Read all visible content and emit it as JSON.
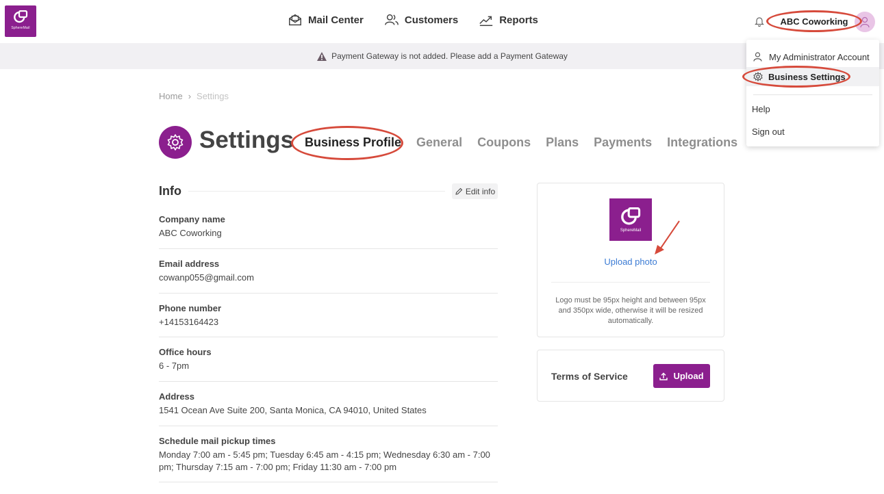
{
  "brand": {
    "name": "SphereMail",
    "color": "#8b1f8e"
  },
  "nav": {
    "items": [
      {
        "label": "Mail Center",
        "icon": "mail-center-icon"
      },
      {
        "label": "Customers",
        "icon": "customers-icon"
      },
      {
        "label": "Reports",
        "icon": "reports-icon"
      }
    ],
    "account_name": "ABC Coworking"
  },
  "banner": {
    "text": "Payment Gateway is not added. Please add a  Payment Gateway"
  },
  "dropdown": {
    "admin_account": "My Administrator Account",
    "business_settings": "Business Settings",
    "help": "Help",
    "sign_out": "Sign out"
  },
  "breadcrumb": {
    "home": "Home",
    "separator": "›",
    "current": "Settings"
  },
  "page": {
    "title": "Settings",
    "tabs": [
      "Business Profile",
      "General",
      "Coupons",
      "Plans",
      "Payments",
      "Integrations"
    ],
    "active_tab": "Business Profile"
  },
  "info": {
    "heading": "Info",
    "edit_label": "Edit info",
    "fields": [
      {
        "label": "Company name",
        "value": "ABC Coworking"
      },
      {
        "label": "Email address",
        "value": "cowanp055@gmail.com"
      },
      {
        "label": "Phone number",
        "value": "+14153164423"
      },
      {
        "label": "Office hours",
        "value": "6 - 7pm"
      },
      {
        "label": "Address",
        "value": "1541 Ocean Ave Suite 200, Santa Monica, CA 94010, United States"
      },
      {
        "label": "Schedule mail pickup times",
        "value": "Monday 7:00 am - 5:45 pm; Tuesday 6:45 am - 4:15 pm; Wednesday 6:30 am - 7:00 pm; Thursday 7:15 am - 7:00 pm; Friday 11:30 am - 7:00 pm"
      }
    ]
  },
  "logo_card": {
    "upload_photo": "Upload photo",
    "note": "Logo must be 95px height and between 95px and 350px wide, otherwise it will be resized automatically."
  },
  "tos_card": {
    "label": "Terms of Service",
    "upload_label": "Upload"
  },
  "annotation_color": "#d64a3b"
}
